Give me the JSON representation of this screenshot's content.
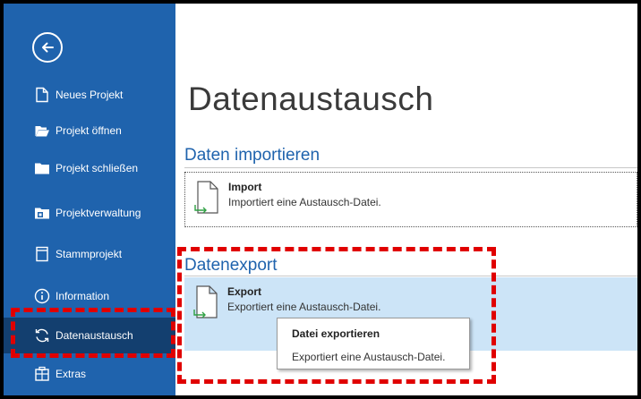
{
  "sidebar": {
    "back_icon": "arrow-left-circle-icon",
    "items": [
      {
        "label": "Neues Projekt",
        "icon": "new-document-icon"
      },
      {
        "label": "Projekt öffnen",
        "icon": "open-folder-icon"
      },
      {
        "label": "Projekt schließen",
        "icon": "folder-icon"
      },
      {
        "label": "Projektverwaltung",
        "icon": "project-management-icon"
      },
      {
        "label": "Stammprojekt",
        "icon": "master-project-icon"
      },
      {
        "label": "Information",
        "icon": "info-icon"
      },
      {
        "label": "Datenaustausch",
        "icon": "sync-icon",
        "active": true
      },
      {
        "label": "Extras",
        "icon": "extras-icon"
      }
    ]
  },
  "main": {
    "title": "Datenaustausch",
    "import_section": {
      "heading": "Daten importieren",
      "item": {
        "name": "Import",
        "description": "Importiert eine Austausch-Datei.",
        "icon": "import-document-icon"
      }
    },
    "export_section": {
      "heading": "Datenexport",
      "item": {
        "name": "Export",
        "description": "Exportiert eine Austausch-Datei.",
        "icon": "export-document-icon"
      }
    }
  },
  "tooltip": {
    "title": "Datei exportieren",
    "body": "Exportiert eine Austausch-Datei."
  },
  "colors": {
    "sidebar_bg": "#1f63ad",
    "sidebar_active": "#133f6f",
    "accent_text": "#1f63ad",
    "selection_bg": "#cce4f7",
    "highlight_red": "#e00000"
  }
}
